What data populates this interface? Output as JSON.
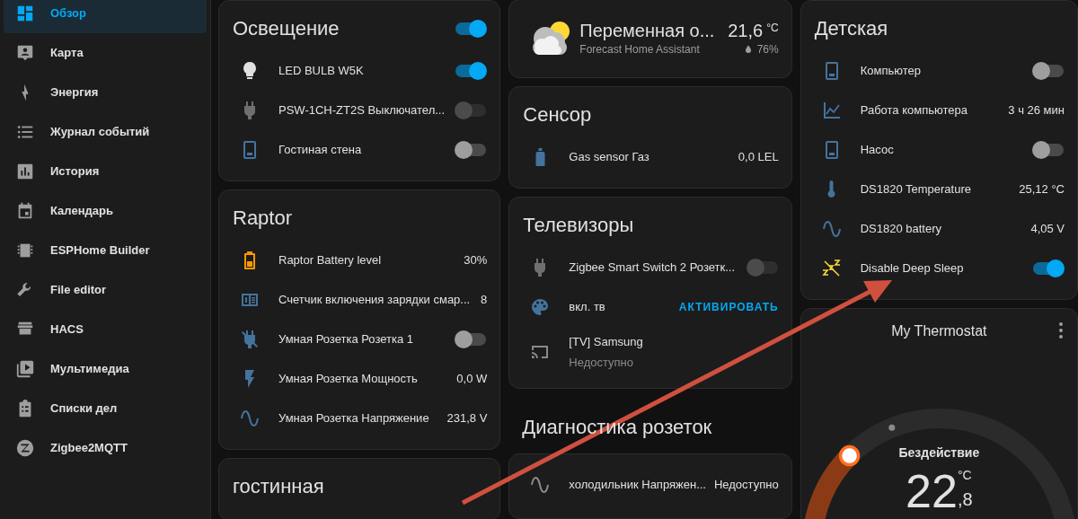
{
  "sidebar": {
    "items": [
      {
        "label": "Обзор",
        "selected": true
      },
      {
        "label": "Карта",
        "selected": false
      },
      {
        "label": "Энергия",
        "selected": false
      },
      {
        "label": "Журнал событий",
        "selected": false
      },
      {
        "label": "История",
        "selected": false
      },
      {
        "label": "Календарь",
        "selected": false
      },
      {
        "label": "ESPHome Builder",
        "selected": false
      },
      {
        "label": "File editor",
        "selected": false
      },
      {
        "label": "HACS",
        "selected": false
      },
      {
        "label": "Мультимедиа",
        "selected": false
      },
      {
        "label": "Списки дел",
        "selected": false
      },
      {
        "label": "Zigbee2MQTT",
        "selected": false
      }
    ]
  },
  "columns": [
    {
      "cards": [
        {
          "kind": "entities",
          "title": "Освещение",
          "header_toggle": {
            "on": true
          },
          "rows": [
            {
              "kind": "toggle",
              "name": "LED BULB W5K",
              "on": true,
              "disabled": false
            },
            {
              "kind": "toggle",
              "name": "PSW-1CH-ZT2S Выключател...",
              "on": false,
              "disabled": true
            },
            {
              "kind": "toggle",
              "name": "Гостиная стена",
              "on": false,
              "disabled": false
            }
          ]
        },
        {
          "kind": "entities",
          "title": "Raptor",
          "rows": [
            {
              "kind": "value",
              "name": "Raptor Battery level",
              "value": "30%"
            },
            {
              "kind": "value",
              "name": "Счетчик включения зарядки смар...",
              "value": "8"
            },
            {
              "kind": "toggle",
              "name": "Умная Розетка Розетка 1",
              "on": false,
              "disabled": false
            },
            {
              "kind": "value",
              "name": "Умная Розетка Мощность",
              "value": "0,0 W"
            },
            {
              "kind": "value",
              "name": "Умная Розетка Напряжение",
              "value": "231,8 V"
            }
          ]
        },
        {
          "kind": "entities",
          "title": "гостинная"
        }
      ]
    },
    {
      "cards": [
        {
          "kind": "weather",
          "condition": "Переменная о...",
          "source": "Forecast Home Assistant",
          "temperature": "21,6",
          "unit": "°C",
          "humidity": "76%"
        },
        {
          "kind": "entities",
          "title": "Сенсор",
          "rows": [
            {
              "kind": "value",
              "name": "Gas sensor Газ",
              "value": "0,0 LEL"
            }
          ]
        },
        {
          "kind": "entities",
          "title": "Телевизоры",
          "rows": [
            {
              "kind": "toggle",
              "name": "Zigbee Smart Switch 2 Розетк...",
              "on": false,
              "disabled": true
            },
            {
              "kind": "button",
              "name": "вкл. тв",
              "action": "АКТИВИРОВАТЬ"
            },
            {
              "kind": "media",
              "name": "[TV] Samsung",
              "state": "Недоступно"
            }
          ]
        },
        {
          "kind": "heading",
          "title": "Диагностика розеток"
        },
        {
          "kind": "entities",
          "rows": [
            {
              "kind": "value",
              "name": "холодильник Напряжен...",
              "value": "Недоступно"
            }
          ]
        }
      ]
    },
    {
      "cards": [
        {
          "kind": "entities",
          "title": "Детская",
          "rows": [
            {
              "kind": "toggle",
              "name": "Компьютер",
              "on": false,
              "disabled": false
            },
            {
              "kind": "value",
              "name": "Работа компьютера",
              "value": "3 ч 26 мин"
            },
            {
              "kind": "toggle",
              "name": "Насос",
              "on": false,
              "disabled": false
            },
            {
              "kind": "value",
              "name": "DS1820 Temperature",
              "value": "25,12 °C"
            },
            {
              "kind": "value",
              "name": "DS1820 battery",
              "value": "4,05 V"
            },
            {
              "kind": "toggle",
              "name": "Disable Deep Sleep",
              "on": true,
              "disabled": false
            }
          ]
        },
        {
          "kind": "thermostat",
          "title": "My Thermostat",
          "action": "Бездействие",
          "temperature_whole": "22",
          "temperature_decimal": ",8",
          "unit": "°C"
        }
      ]
    }
  ]
}
